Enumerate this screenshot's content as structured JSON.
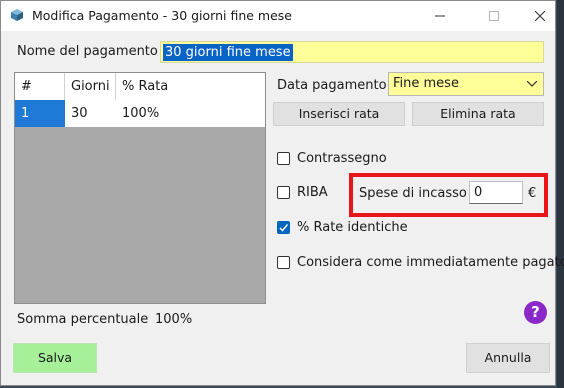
{
  "window": {
    "title": "Modifica Pagamento - 30 giorni fine mese",
    "icon": "app-cube-icon"
  },
  "form": {
    "name_label": "Nome del pagamento",
    "name_value": "30 giorni fine mese",
    "date_label": "Data pagamento",
    "date_value": "Fine mese",
    "insert_label": "Inserisci rata",
    "delete_label": "Elimina rata"
  },
  "table": {
    "columns": [
      "#",
      "Giorni",
      "% Rata"
    ],
    "rows": [
      [
        "1",
        "30",
        "100%"
      ]
    ]
  },
  "options": {
    "contrassegno": {
      "label": "Contrassegno",
      "checked": false
    },
    "riba": {
      "label": "RIBA",
      "checked": false
    },
    "spese_label": "Spese di incasso",
    "spese_value": "0",
    "currency": "€",
    "rate_identiche": {
      "label": "% Rate identiche",
      "checked": true
    },
    "immediatamente": {
      "label": "Considera come immediatamente pagato",
      "checked": false
    }
  },
  "summary": {
    "label": "Somma percentuale",
    "value": "100%"
  },
  "help_glyph": "?",
  "buttons": {
    "save": "Salva",
    "cancel": "Annulla"
  },
  "colors": {
    "field_yellow": "#ffff99",
    "selection_blue": "#0a64c8",
    "highlight_red": "#e8161a",
    "save_green": "#a6f09a",
    "help_purple": "#8b28c8"
  }
}
